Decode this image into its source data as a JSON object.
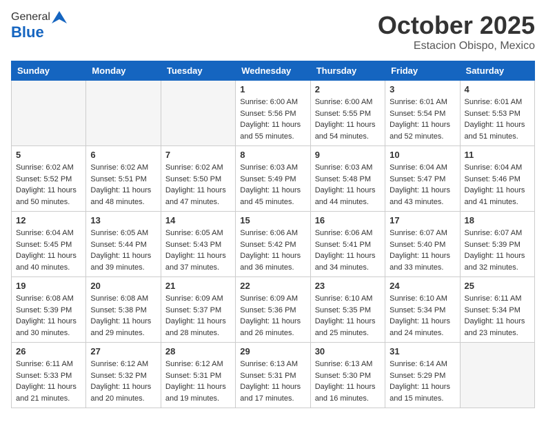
{
  "header": {
    "logo_general": "General",
    "logo_blue": "Blue",
    "month": "October 2025",
    "location": "Estacion Obispo, Mexico"
  },
  "days_of_week": [
    "Sunday",
    "Monday",
    "Tuesday",
    "Wednesday",
    "Thursday",
    "Friday",
    "Saturday"
  ],
  "weeks": [
    [
      {
        "day": "",
        "info": ""
      },
      {
        "day": "",
        "info": ""
      },
      {
        "day": "",
        "info": ""
      },
      {
        "day": "1",
        "sunrise": "6:00 AM",
        "sunset": "5:56 PM",
        "daylight": "11 hours and 55 minutes."
      },
      {
        "day": "2",
        "sunrise": "6:00 AM",
        "sunset": "5:55 PM",
        "daylight": "11 hours and 54 minutes."
      },
      {
        "day": "3",
        "sunrise": "6:01 AM",
        "sunset": "5:54 PM",
        "daylight": "11 hours and 52 minutes."
      },
      {
        "day": "4",
        "sunrise": "6:01 AM",
        "sunset": "5:53 PM",
        "daylight": "11 hours and 51 minutes."
      }
    ],
    [
      {
        "day": "5",
        "sunrise": "6:02 AM",
        "sunset": "5:52 PM",
        "daylight": "11 hours and 50 minutes."
      },
      {
        "day": "6",
        "sunrise": "6:02 AM",
        "sunset": "5:51 PM",
        "daylight": "11 hours and 48 minutes."
      },
      {
        "day": "7",
        "sunrise": "6:02 AM",
        "sunset": "5:50 PM",
        "daylight": "11 hours and 47 minutes."
      },
      {
        "day": "8",
        "sunrise": "6:03 AM",
        "sunset": "5:49 PM",
        "daylight": "11 hours and 45 minutes."
      },
      {
        "day": "9",
        "sunrise": "6:03 AM",
        "sunset": "5:48 PM",
        "daylight": "11 hours and 44 minutes."
      },
      {
        "day": "10",
        "sunrise": "6:04 AM",
        "sunset": "5:47 PM",
        "daylight": "11 hours and 43 minutes."
      },
      {
        "day": "11",
        "sunrise": "6:04 AM",
        "sunset": "5:46 PM",
        "daylight": "11 hours and 41 minutes."
      }
    ],
    [
      {
        "day": "12",
        "sunrise": "6:04 AM",
        "sunset": "5:45 PM",
        "daylight": "11 hours and 40 minutes."
      },
      {
        "day": "13",
        "sunrise": "6:05 AM",
        "sunset": "5:44 PM",
        "daylight": "11 hours and 39 minutes."
      },
      {
        "day": "14",
        "sunrise": "6:05 AM",
        "sunset": "5:43 PM",
        "daylight": "11 hours and 37 minutes."
      },
      {
        "day": "15",
        "sunrise": "6:06 AM",
        "sunset": "5:42 PM",
        "daylight": "11 hours and 36 minutes."
      },
      {
        "day": "16",
        "sunrise": "6:06 AM",
        "sunset": "5:41 PM",
        "daylight": "11 hours and 34 minutes."
      },
      {
        "day": "17",
        "sunrise": "6:07 AM",
        "sunset": "5:40 PM",
        "daylight": "11 hours and 33 minutes."
      },
      {
        "day": "18",
        "sunrise": "6:07 AM",
        "sunset": "5:39 PM",
        "daylight": "11 hours and 32 minutes."
      }
    ],
    [
      {
        "day": "19",
        "sunrise": "6:08 AM",
        "sunset": "5:39 PM",
        "daylight": "11 hours and 30 minutes."
      },
      {
        "day": "20",
        "sunrise": "6:08 AM",
        "sunset": "5:38 PM",
        "daylight": "11 hours and 29 minutes."
      },
      {
        "day": "21",
        "sunrise": "6:09 AM",
        "sunset": "5:37 PM",
        "daylight": "11 hours and 28 minutes."
      },
      {
        "day": "22",
        "sunrise": "6:09 AM",
        "sunset": "5:36 PM",
        "daylight": "11 hours and 26 minutes."
      },
      {
        "day": "23",
        "sunrise": "6:10 AM",
        "sunset": "5:35 PM",
        "daylight": "11 hours and 25 minutes."
      },
      {
        "day": "24",
        "sunrise": "6:10 AM",
        "sunset": "5:34 PM",
        "daylight": "11 hours and 24 minutes."
      },
      {
        "day": "25",
        "sunrise": "6:11 AM",
        "sunset": "5:34 PM",
        "daylight": "11 hours and 23 minutes."
      }
    ],
    [
      {
        "day": "26",
        "sunrise": "6:11 AM",
        "sunset": "5:33 PM",
        "daylight": "11 hours and 21 minutes."
      },
      {
        "day": "27",
        "sunrise": "6:12 AM",
        "sunset": "5:32 PM",
        "daylight": "11 hours and 20 minutes."
      },
      {
        "day": "28",
        "sunrise": "6:12 AM",
        "sunset": "5:31 PM",
        "daylight": "11 hours and 19 minutes."
      },
      {
        "day": "29",
        "sunrise": "6:13 AM",
        "sunset": "5:31 PM",
        "daylight": "11 hours and 17 minutes."
      },
      {
        "day": "30",
        "sunrise": "6:13 AM",
        "sunset": "5:30 PM",
        "daylight": "11 hours and 16 minutes."
      },
      {
        "day": "31",
        "sunrise": "6:14 AM",
        "sunset": "5:29 PM",
        "daylight": "11 hours and 15 minutes."
      },
      {
        "day": "",
        "info": ""
      }
    ]
  ]
}
